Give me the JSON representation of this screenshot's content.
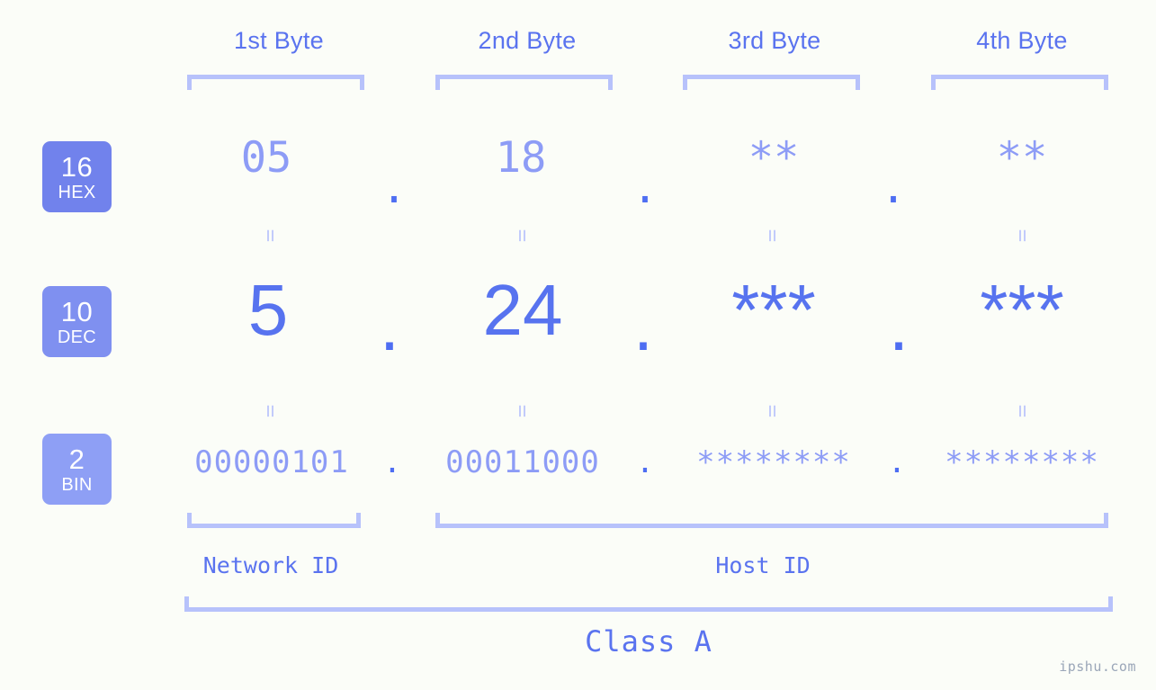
{
  "background_color": "#fbfdf8",
  "accent_color": "#5a73ef",
  "muted_accent_color": "#8d9cf6",
  "bracket_color": "#b7c2fb",
  "byte_headers": [
    {
      "label": "1st Byte"
    },
    {
      "label": "2nd Byte"
    },
    {
      "label": "3rd Byte"
    },
    {
      "label": "4th Byte"
    }
  ],
  "radix_rows": [
    {
      "badge_number": "16",
      "badge_name": "HEX",
      "badge_color": "#7182ec",
      "values": [
        "05",
        "18",
        "**",
        "**"
      ],
      "separator": "."
    },
    {
      "badge_number": "10",
      "badge_name": "DEC",
      "badge_color": "#7f90f0",
      "values": [
        "5",
        "24",
        "***",
        "***"
      ],
      "separator": "."
    },
    {
      "badge_number": "2",
      "badge_name": "BIN",
      "badge_color": "#8e9ff5",
      "values": [
        "00000101",
        "00011000",
        "********",
        "********"
      ],
      "separator": "."
    }
  ],
  "equality_symbol": "=",
  "segments": {
    "network_id_label": "Network ID",
    "host_id_label": "Host ID"
  },
  "class_label": "Class A",
  "watermark": "ipshu.com"
}
